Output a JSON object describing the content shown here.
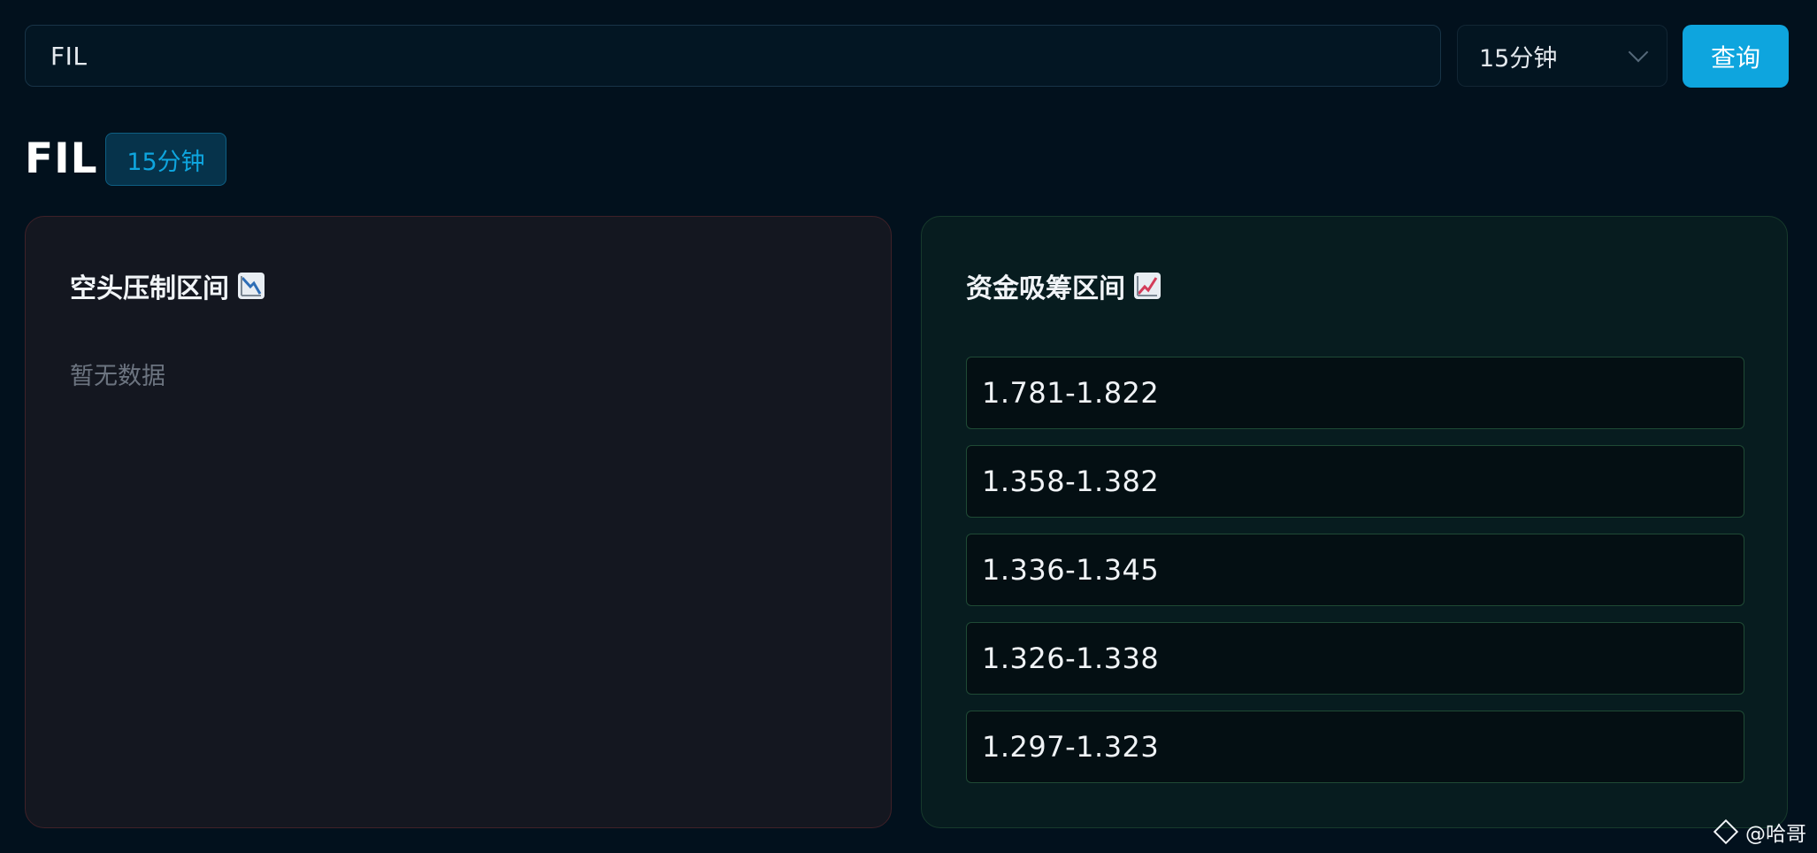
{
  "search": {
    "value": "FIL"
  },
  "interval_select": {
    "value": "15分钟",
    "icon": "chevron-down-icon"
  },
  "query_button": {
    "label": "查询"
  },
  "symbol": {
    "title": "FIL",
    "badge": "15分钟"
  },
  "bearish_panel": {
    "title": "空头压制区间",
    "icon": "chart-decreasing-icon",
    "empty_text": "暂无数据",
    "border_color": "#3f2128"
  },
  "bullish_panel": {
    "title": "资金吸筹区间",
    "icon": "chart-increasing-icon",
    "ranges": [
      "1.781-1.822",
      "1.358-1.382",
      "1.336-1.345",
      "1.326-1.338",
      "1.297-1.323"
    ],
    "border_color": "#1f4a35"
  },
  "watermark": {
    "text": "@哈哥",
    "icon": "diamond-logo-icon"
  },
  "colors": {
    "accent": "#0ea5de",
    "background": "#02111d"
  }
}
